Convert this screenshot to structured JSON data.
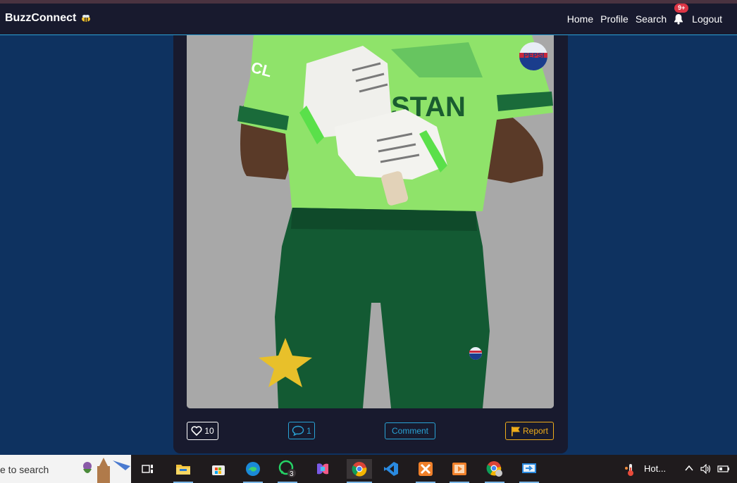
{
  "app": {
    "brand": "BuzzConnect"
  },
  "nav": {
    "home": "Home",
    "profile": "Profile",
    "search": "Search",
    "notifications_badge": "9+",
    "logout": "Logout"
  },
  "post": {
    "like_count": "10",
    "comment_count": "1",
    "comment_label": "Comment",
    "report_label": "Report",
    "image_text": {
      "sponsor": "PEPSI",
      "shirt": "STAN",
      "sleeve": "CL"
    }
  },
  "taskbar": {
    "search_text": "e to search",
    "whatsapp_badge": "3",
    "weather": "Hot...",
    "icons": [
      "task-view-icon",
      "file-explorer-icon",
      "store-icon",
      "edge-icon",
      "whatsapp-icon",
      "copilot-icon",
      "chrome-icon",
      "vscode-icon",
      "xampp-icon",
      "media-player-icon",
      "chrome-profile-icon",
      "remote-desktop-icon"
    ]
  },
  "colors": {
    "background": "#0e3260",
    "navbar": "#181a2e",
    "accent": "#29a3d6",
    "report": "#f0ad1a",
    "badge": "#dc3545"
  }
}
